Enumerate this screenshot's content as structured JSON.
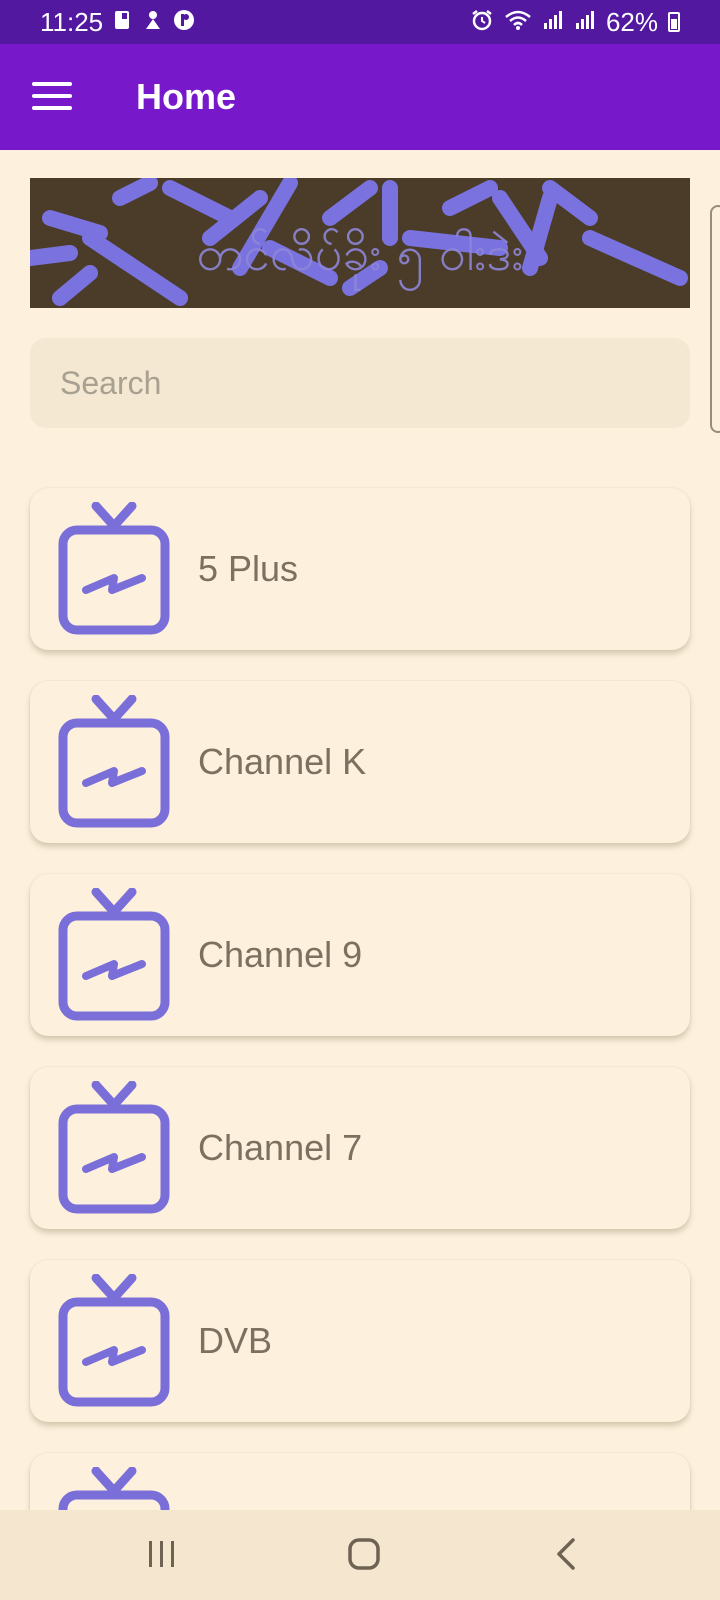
{
  "status_bar": {
    "time": "11:25",
    "battery": "62%",
    "left_icons": [
      "sim-card-icon",
      "notification-icon",
      "app-notification-icon"
    ],
    "right_icons": [
      "alarm-icon",
      "wifi-icon",
      "signal-icon",
      "signal-icon",
      "battery-icon"
    ]
  },
  "app_bar": {
    "title": "Home",
    "menu_icon": "hamburger-menu-icon"
  },
  "banner": {
    "text": "တင်လိပ်ခိုး ၅ ဝါးဒဲး"
  },
  "search": {
    "placeholder": "Search",
    "value": ""
  },
  "channels": [
    {
      "name": "5 Plus",
      "icon": "tv-icon"
    },
    {
      "name": "Channel K",
      "icon": "tv-icon"
    },
    {
      "name": "Channel 9",
      "icon": "tv-icon"
    },
    {
      "name": "Channel 7",
      "icon": "tv-icon"
    },
    {
      "name": "DVB",
      "icon": "tv-icon"
    },
    {
      "name": "",
      "icon": "tv-icon"
    }
  ],
  "nav_bar": {
    "buttons": [
      "recent-apps-icon",
      "home-icon",
      "back-icon"
    ]
  },
  "colors": {
    "status_bar": "#5218a0",
    "app_bar": "#7719ca",
    "background": "#fdf1dd",
    "icon_accent": "#7a6fd8",
    "channel_text": "#7c7060"
  }
}
